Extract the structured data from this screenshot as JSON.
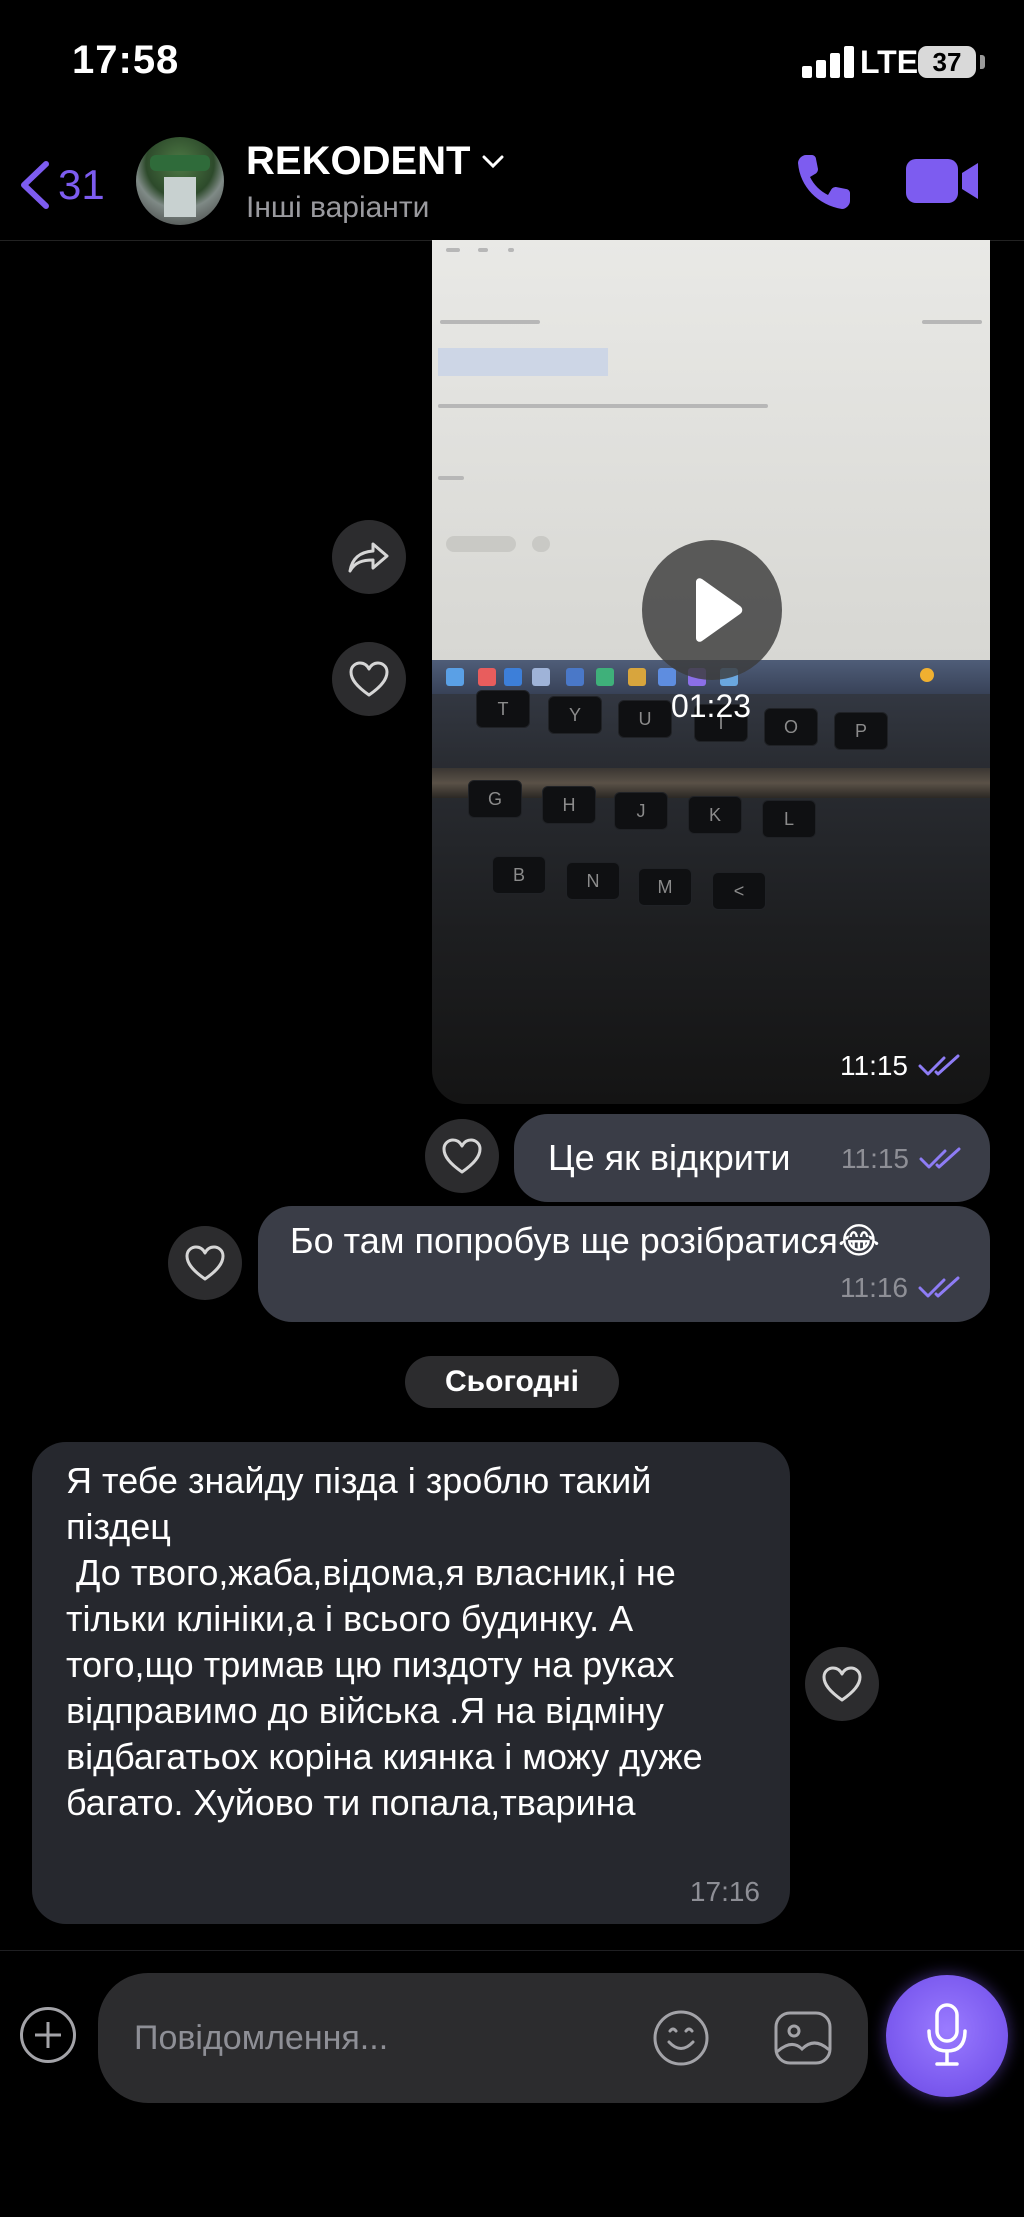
{
  "status_bar": {
    "time": "17:58",
    "network": "LTE",
    "battery": "37"
  },
  "header": {
    "back_count": "31",
    "contact_name": "REKODENT",
    "subtitle": "Інші варіанти"
  },
  "video_message": {
    "duration": "01:23",
    "time": "11:15"
  },
  "keyboard_keys": [
    "T",
    "Y",
    "U",
    "I",
    "O",
    "P",
    "G",
    "H",
    "J",
    "K",
    "L",
    "B",
    "N",
    "M",
    "<"
  ],
  "messages": [
    {
      "text": "Це як відкрити",
      "time": "11:15"
    },
    {
      "text": "Бо там попробув ще розібратися😂",
      "time": "11:16"
    }
  ],
  "date_separator": "Сьогодні",
  "incoming": {
    "text": "Я тебе знайду пізда і зроблю такий піздец\n До твого,жаба,відома,я власник,і не тільки клініки,а і всього будинку. А того,що тримав цю пиздоту на руках відправимо до війська .Я на відміну відбагатьох коріна киянка і можу дуже багато. Хуйово ти попала,тварина",
    "time": "17:16"
  },
  "composer": {
    "placeholder": "Повідомлення..."
  },
  "colors": {
    "accent": "#7d5cf0",
    "bubble_out": "#3a3d47",
    "bubble_in": "#26282e",
    "read_ticks": "#8e7cf5"
  }
}
